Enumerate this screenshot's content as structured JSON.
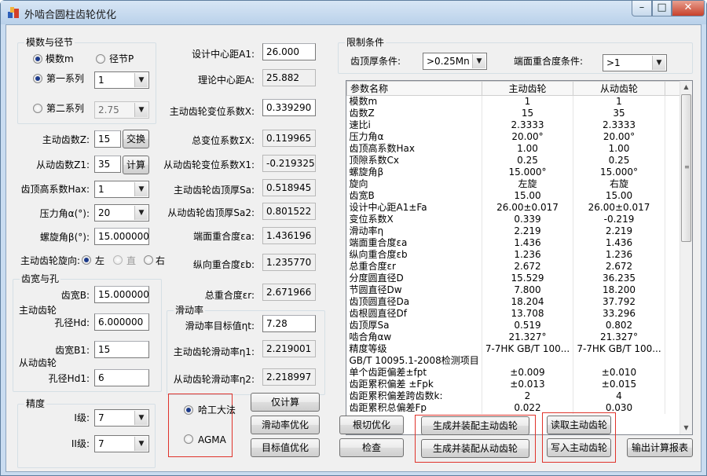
{
  "window": {
    "title": "外啮合圆柱齿轮优化",
    "minimize": "–",
    "maximize": "□",
    "close": "✕"
  },
  "module_group": {
    "title": "模数与径节",
    "radio_module": "模数m",
    "radio_pitch": "径节P",
    "radio_series1": "第一系列",
    "series1_value": "1",
    "radio_series2": "第二系列",
    "series2_value": "2.75"
  },
  "inputs": {
    "driver_teeth_label": "主动齿数Z:",
    "driver_teeth_value": "15",
    "swap_button": "交换",
    "driven_teeth_label": "从动齿数Z1:",
    "driven_teeth_value": "35",
    "compute_button": "计算",
    "addendum_label": "齿顶高系数Hax:",
    "addendum_value": "1",
    "pressure_label": "压力角α(°):",
    "pressure_value": "20",
    "helix_label": "螺旋角β(°):",
    "helix_value": "15.000000",
    "direction_label": "主动齿轮旋向:",
    "direction_left": "左",
    "direction_straight": "直",
    "direction_right": "右"
  },
  "width_group": {
    "title": "齿宽与孔",
    "driver_label": "主动齿轮",
    "width_b_label": "齿宽B:",
    "width_b_value": "15.000000",
    "bore_hd_label": "孔径Hd:",
    "bore_hd_value": "6.000000",
    "width_b1_label": "齿宽B1:",
    "width_b1_value": "15",
    "driven_label": "从动齿轮",
    "bore_hd1_label": "孔径Hd1:",
    "bore_hd1_value": "6"
  },
  "precision_group": {
    "title": "精度",
    "grade1_label": "I级:",
    "grade1_value": "7",
    "grade2_label": "II级:",
    "grade2_value": "7"
  },
  "center": {
    "design_center_label": "设计中心距A1:",
    "design_center_value": "26.000",
    "theory_center_label": "理论中心距A:",
    "theory_center_value": "25.882",
    "driver_shift_label": "主动齿轮变位系数X:",
    "driver_shift_value": "0.339290",
    "total_shift_label": "总变位系数ΣX:",
    "total_shift_value": "0.119965",
    "driven_shift_label": "从动齿轮变位系数X1:",
    "driven_shift_value": "-0.219325",
    "driver_thick_label": "主动齿轮齿顶厚Sa:",
    "driver_thick_value": "0.518945",
    "driven_thick_label": "从动齿轮齿顶厚Sa2:",
    "driven_thick_value": "0.801522",
    "face_contact_label": "端面重合度εa:",
    "face_contact_value": "1.436196",
    "axial_contact_label": "纵向重合度εb:",
    "axial_contact_value": "1.235770",
    "total_contact_label": "总重合度εr:",
    "total_contact_value": "2.671966"
  },
  "slip_group": {
    "title": "滑动率",
    "target_label": "滑动率目标值ηt:",
    "target_value": "7.28",
    "driver_label": "主动齿轮滑动率η1:",
    "driver_value": "2.219001",
    "driven_label": "从动齿轮滑动率η2:",
    "driven_value": "2.218997"
  },
  "method": {
    "hit": "哈工大法",
    "agma": "AGMA"
  },
  "buttons": {
    "calc_only": "仅计算",
    "slip_optimize": "滑动率优化",
    "target_optimize": "目标值优化",
    "root_optimize": "根切优化",
    "check": "检查",
    "gen_driver": "生成并装配主动齿轮",
    "gen_driven": "生成并装配从动齿轮",
    "read_driver": "读取主动齿轮",
    "write_driver": "写入主动齿轮",
    "export_report": "输出计算报表"
  },
  "constraints": {
    "title": "限制条件",
    "thickness_label": "齿顶厚条件:",
    "thickness_value": ">0.25Mn",
    "overlap_label": "端面重合度条件:",
    "overlap_value": ">1"
  },
  "table": {
    "headers": [
      "参数名称",
      "主动齿轮",
      "从动齿轮"
    ],
    "rows": [
      [
        "模数m",
        "1",
        "1"
      ],
      [
        "齿数Z",
        "15",
        "35"
      ],
      [
        "速比i",
        "2.3333",
        "2.3333"
      ],
      [
        "压力角α",
        "20.00°",
        "20.00°"
      ],
      [
        "齿顶高系数Hax",
        "1.00",
        "1.00"
      ],
      [
        "顶隙系数Cx",
        "0.25",
        "0.25"
      ],
      [
        "螺旋角β",
        "15.000°",
        "15.000°"
      ],
      [
        "旋向",
        "左旋",
        "右旋"
      ],
      [
        "齿宽B",
        "15.00",
        "15.00"
      ],
      [
        "设计中心距A1±Fa",
        "26.00±0.017",
        "26.00±0.017"
      ],
      [
        "变位系数X",
        "0.339",
        "-0.219"
      ],
      [
        "滑动率η",
        "2.219",
        "2.219"
      ],
      [
        "端面重合度εa",
        "1.436",
        "1.436"
      ],
      [
        "纵向重合度εb",
        "1.236",
        "1.236"
      ],
      [
        "总重合度εr",
        "2.672",
        "2.672"
      ],
      [
        "分度圆直径D",
        "15.529",
        "36.235"
      ],
      [
        "节圆直径Dw",
        "7.800",
        "18.200"
      ],
      [
        "齿顶圆直径Da",
        "18.204",
        "37.792"
      ],
      [
        "齿根圆直径Df",
        "13.708",
        "33.296"
      ],
      [
        "齿顶厚Sa",
        "0.519",
        "0.802"
      ],
      [
        "啮合角αw",
        "21.327°",
        "21.327°"
      ],
      [
        "精度等级",
        "7-7HK GB/T 100...",
        "7-7HK GB/T 100..."
      ],
      [
        "GB/T 10095.1-2008检测项目",
        "",
        ""
      ],
      [
        "单个齿距偏差±fpt",
        "±0.009",
        "±0.010"
      ],
      [
        "齿距累积偏差 ±Fpk",
        "±0.013",
        "±0.015"
      ],
      [
        "齿距累积偏差跨齿数k:",
        "2",
        "4"
      ],
      [
        "齿距累积总偏差Fp",
        "0.022",
        "0.030"
      ]
    ]
  }
}
